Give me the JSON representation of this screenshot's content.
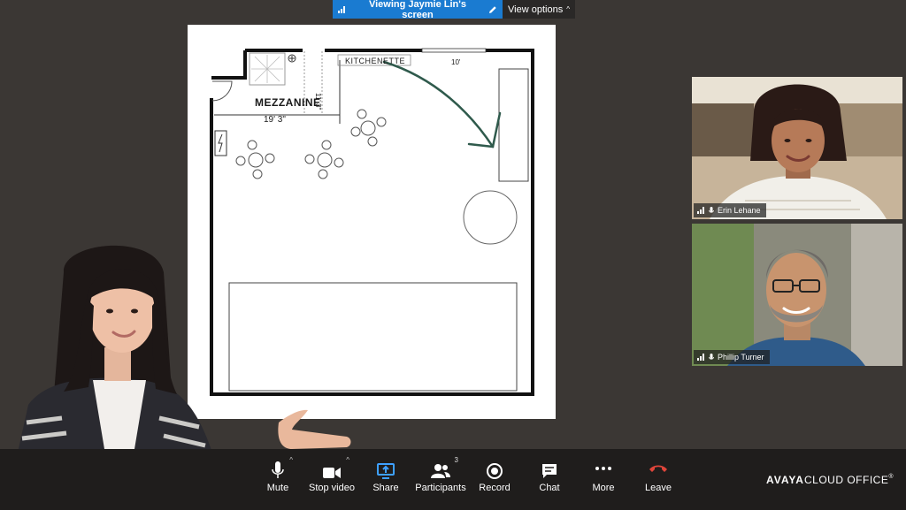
{
  "banner": {
    "title": "Viewing Jaymie Lin's screen",
    "view_options": "View options"
  },
  "floorplan": {
    "kitchenette": "KITCHENETTE",
    "mezzanine": "MEZZANINE",
    "dim_width": "19' 3\"",
    "dim_height": "11' 3\"",
    "dim_top": "10'"
  },
  "participants": [
    {
      "name": "Erin Lehane"
    },
    {
      "name": "Phillip Turner"
    }
  ],
  "toolbar": {
    "mute": "Mute",
    "stop_video": "Stop video",
    "share": "Share",
    "participants": "Participants",
    "participants_count": "3",
    "record": "Record",
    "chat": "Chat",
    "more": "More",
    "leave": "Leave"
  },
  "brand": {
    "name": "AVAYA",
    "product": "CLOUD OFFICE"
  },
  "colors": {
    "banner": "#1a7bd1",
    "share_accent": "#3ea0ff",
    "leave": "#e0453a",
    "annotation": "#2f5a4c"
  }
}
